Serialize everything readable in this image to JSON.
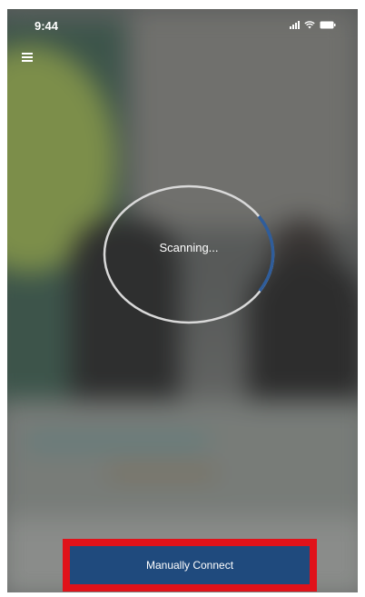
{
  "status_bar": {
    "time": "9:44",
    "icons": [
      "signal-icon",
      "wifi-icon",
      "battery-icon"
    ]
  },
  "header": {
    "menu_icon": "hamburger-menu-icon"
  },
  "scanner": {
    "status_text": "Scanning...",
    "progress_arc_color": "#2f5d9b"
  },
  "actions": {
    "manually_connect_label": "Manually Connect",
    "button_color": "#1f4a7d",
    "highlight_color": "#e0121a"
  }
}
